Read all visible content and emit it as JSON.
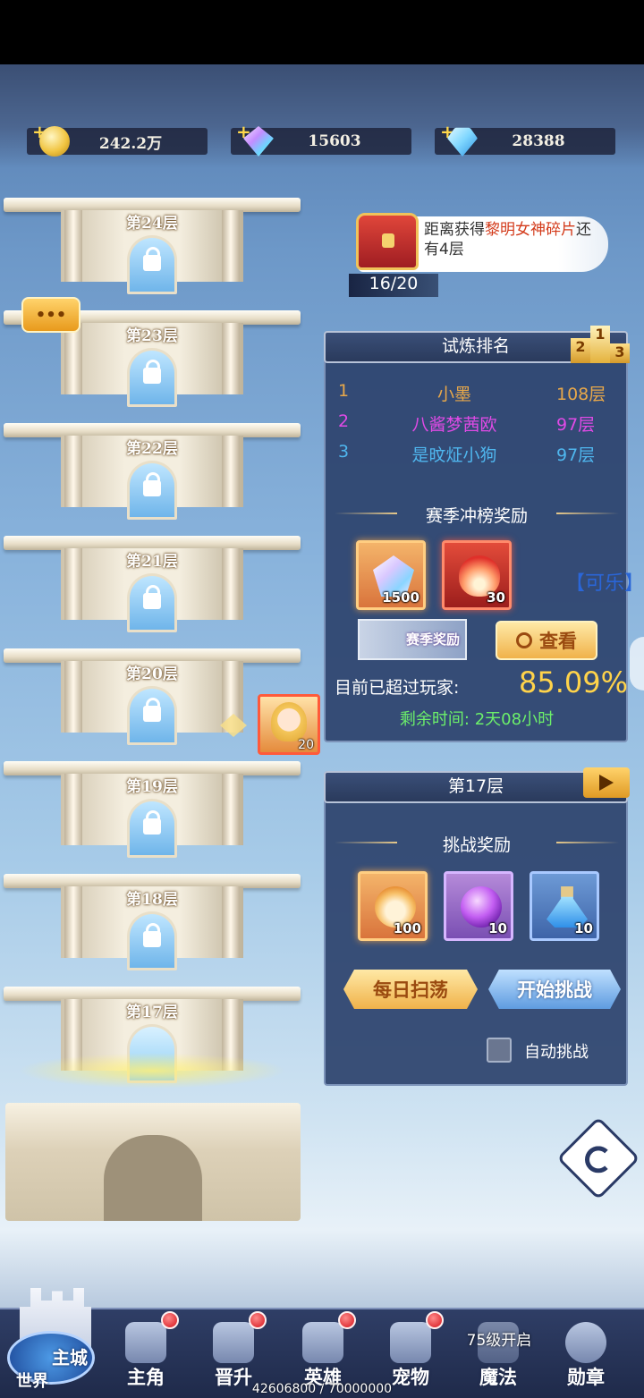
{
  "resources": [
    {
      "value": "242.2万",
      "icon": "gold-coin-icon"
    },
    {
      "value": "15603",
      "icon": "rainbow-gem-icon"
    },
    {
      "value": "28388",
      "icon": "diamond-icon"
    }
  ],
  "tower": {
    "floors": [
      {
        "label": "第24层",
        "state": "locked"
      },
      {
        "label": "第23层",
        "state": "locked"
      },
      {
        "label": "第22层",
        "state": "locked"
      },
      {
        "label": "第21层",
        "state": "locked"
      },
      {
        "label": "第20层",
        "state": "locked"
      },
      {
        "label": "第19层",
        "state": "locked"
      },
      {
        "label": "第18层",
        "state": "locked"
      },
      {
        "label": "第17层",
        "state": "current"
      }
    ],
    "player_marker_level": "20"
  },
  "chest": {
    "text_prefix": "距离获得",
    "text_highlight": "黎明女神碎片",
    "text_suffix": "还有4层",
    "progress": "16/20"
  },
  "ranking": {
    "title": "试炼排名",
    "rows": [
      {
        "rank": "1",
        "name": "小墨",
        "floor": "108层",
        "color": "#e8a84a"
      },
      {
        "rank": "2",
        "name": "八酱梦茜欧",
        "floor": "97层",
        "color": "#e04ae6"
      },
      {
        "rank": "3",
        "name": "是旼炡小狗",
        "floor": "97层",
        "color": "#4fb6ee"
      }
    ],
    "season_reward_title": "赛季冲榜奖励",
    "rewards": [
      {
        "qty": "1500",
        "icon": "crystal-icon"
      },
      {
        "qty": "30",
        "icon": "flame-icon"
      }
    ],
    "season_badge": "赛季奖励",
    "view_button": "查看",
    "side_tag": "【可乐】",
    "surpass_label": "目前已超过玩家:",
    "surpass_value": "85.09%",
    "remaining": "剩余时间: 2天08小时"
  },
  "floor_panel": {
    "title": "第17层",
    "challenge_reward_title": "挑战奖励",
    "rewards": [
      {
        "qty": "100",
        "icon": "fire-spirit-icon"
      },
      {
        "qty": "10",
        "icon": "crystal-ball-icon"
      },
      {
        "qty": "10",
        "icon": "potion-icon"
      }
    ],
    "daily_sweep": "每日扫荡",
    "start_challenge": "开始挑战",
    "auto_challenge": "自动挑战"
  },
  "nav": {
    "home_top": "主城",
    "home_bottom": "世界",
    "items": [
      {
        "label": "主角",
        "dot": true
      },
      {
        "label": "晋升",
        "dot": true
      },
      {
        "label": "英雄",
        "dot": true
      },
      {
        "label": "宠物",
        "dot": true
      },
      {
        "label": "魔法",
        "dot": false,
        "note": "75级开启"
      },
      {
        "label": "勋章",
        "dot": false
      }
    ]
  },
  "exp": "42606800 / 70000000"
}
